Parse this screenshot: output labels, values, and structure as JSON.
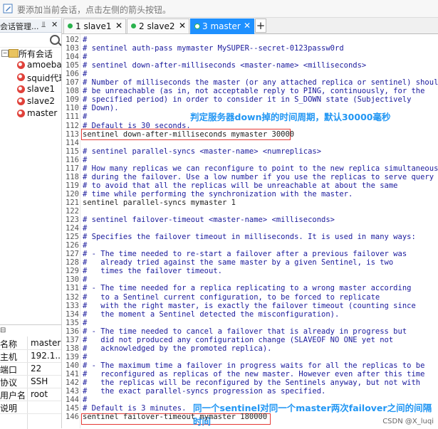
{
  "topbar": {
    "hint": "要添加当前会话，点击左侧的箭头按钮。"
  },
  "sessions": {
    "title": "会话管理...",
    "tree": [
      {
        "label": "所有会话",
        "kind": "folder"
      },
      {
        "label": "amoeba",
        "kind": "session"
      },
      {
        "label": "squid代理",
        "kind": "session"
      },
      {
        "label": "slave1",
        "kind": "session"
      },
      {
        "label": "slave2",
        "kind": "session"
      },
      {
        "label": "master",
        "kind": "session"
      }
    ],
    "props": [
      {
        "k": "名称",
        "v": "master"
      },
      {
        "k": "主机",
        "v": "192.1..."
      },
      {
        "k": "端口",
        "v": "22"
      },
      {
        "k": "协议",
        "v": "SSH"
      },
      {
        "k": "用户名",
        "v": "root"
      },
      {
        "k": "说明",
        "v": ""
      }
    ]
  },
  "tabs": [
    {
      "label": "1 slave1"
    },
    {
      "label": "2 slave2"
    },
    {
      "label": "3 master",
      "active": true
    }
  ],
  "lines": [
    {
      "n": "102",
      "t": "#"
    },
    {
      "n": "103",
      "t": "# sentinel auth-pass mymaster MySUPER--secret-0123passw0rd"
    },
    {
      "n": "104",
      "t": "#"
    },
    {
      "n": "105",
      "t": "# sentinel down-after-milliseconds <master-name> <milliseconds>"
    },
    {
      "n": "106",
      "t": "#"
    },
    {
      "n": "107",
      "t": "# Number of milliseconds the master (or any attached replica or sentinel) should"
    },
    {
      "n": "108",
      "t": "# be unreachable (as in, not acceptable reply to PING, continuously, for the"
    },
    {
      "n": "109",
      "t": "# specified period) in order to consider it in S_DOWN state (Subjectively"
    },
    {
      "n": "110",
      "t": "# Down)."
    },
    {
      "n": "111",
      "t": "#"
    },
    {
      "n": "112",
      "t": "# Default is 30 seconds."
    },
    {
      "n": "113",
      "t": "sentinel down-after-milliseconds mymaster 30000",
      "plain": true
    },
    {
      "n": "114",
      "t": ""
    },
    {
      "n": "115",
      "t": "# sentinel parallel-syncs <master-name> <numreplicas>"
    },
    {
      "n": "116",
      "t": "#"
    },
    {
      "n": "117",
      "t": "# How many replicas we can reconfigure to point to the new replica simultaneously"
    },
    {
      "n": "118",
      "t": "# during the failover. Use a low number if you use the replicas to serve query"
    },
    {
      "n": "119",
      "t": "# to avoid that all the replicas will be unreachable at about the same"
    },
    {
      "n": "120",
      "t": "# time while performing the synchronization with the master."
    },
    {
      "n": "121",
      "t": "sentinel parallel-syncs mymaster 1",
      "plain": true
    },
    {
      "n": "122",
      "t": ""
    },
    {
      "n": "123",
      "t": "# sentinel failover-timeout <master-name> <milliseconds>"
    },
    {
      "n": "124",
      "t": "#"
    },
    {
      "n": "125",
      "t": "# Specifies the failover timeout in milliseconds. It is used in many ways:"
    },
    {
      "n": "126",
      "t": "#"
    },
    {
      "n": "127",
      "t": "# - The time needed to re-start a failover after a previous failover was"
    },
    {
      "n": "128",
      "t": "#   already tried against the same master by a given Sentinel, is two"
    },
    {
      "n": "129",
      "t": "#   times the failover timeout."
    },
    {
      "n": "130",
      "t": "#"
    },
    {
      "n": "131",
      "t": "# - The time needed for a replica replicating to a wrong master according"
    },
    {
      "n": "132",
      "t": "#   to a Sentinel current configuration, to be forced to replicate"
    },
    {
      "n": "133",
      "t": "#   with the right master, is exactly the failover timeout (counting since"
    },
    {
      "n": "134",
      "t": "#   the moment a Sentinel detected the misconfiguration)."
    },
    {
      "n": "135",
      "t": "#"
    },
    {
      "n": "136",
      "t": "# - The time needed to cancel a failover that is already in progress but"
    },
    {
      "n": "137",
      "t": "#   did not produced any configuration change (SLAVEOF NO ONE yet not"
    },
    {
      "n": "138",
      "t": "#   acknowledged by the promoted replica)."
    },
    {
      "n": "139",
      "t": "#"
    },
    {
      "n": "140",
      "t": "# - The maximum time a failover in progress waits for all the replicas to be"
    },
    {
      "n": "141",
      "t": "#   reconfigured as replicas of the new master. However even after this time"
    },
    {
      "n": "142",
      "t": "#   the replicas will be reconfigured by the Sentinels anyway, but not with"
    },
    {
      "n": "143",
      "t": "#   the exact parallel-syncs progression as specified."
    },
    {
      "n": "144",
      "t": "#"
    },
    {
      "n": "145",
      "t": "# Default is 3 minutes."
    },
    {
      "n": "146",
      "t": "sentinel failover-timeout mymaster 180000",
      "plain": true
    }
  ],
  "annotations": {
    "note1": "判定服务器down掉的时间周期，默认30000毫秒",
    "note2_line1": "同一个sentinel对同一个master两次failover之间的间隔",
    "note2_line2": "时间"
  },
  "watermark": "CSDN @X_luqi"
}
